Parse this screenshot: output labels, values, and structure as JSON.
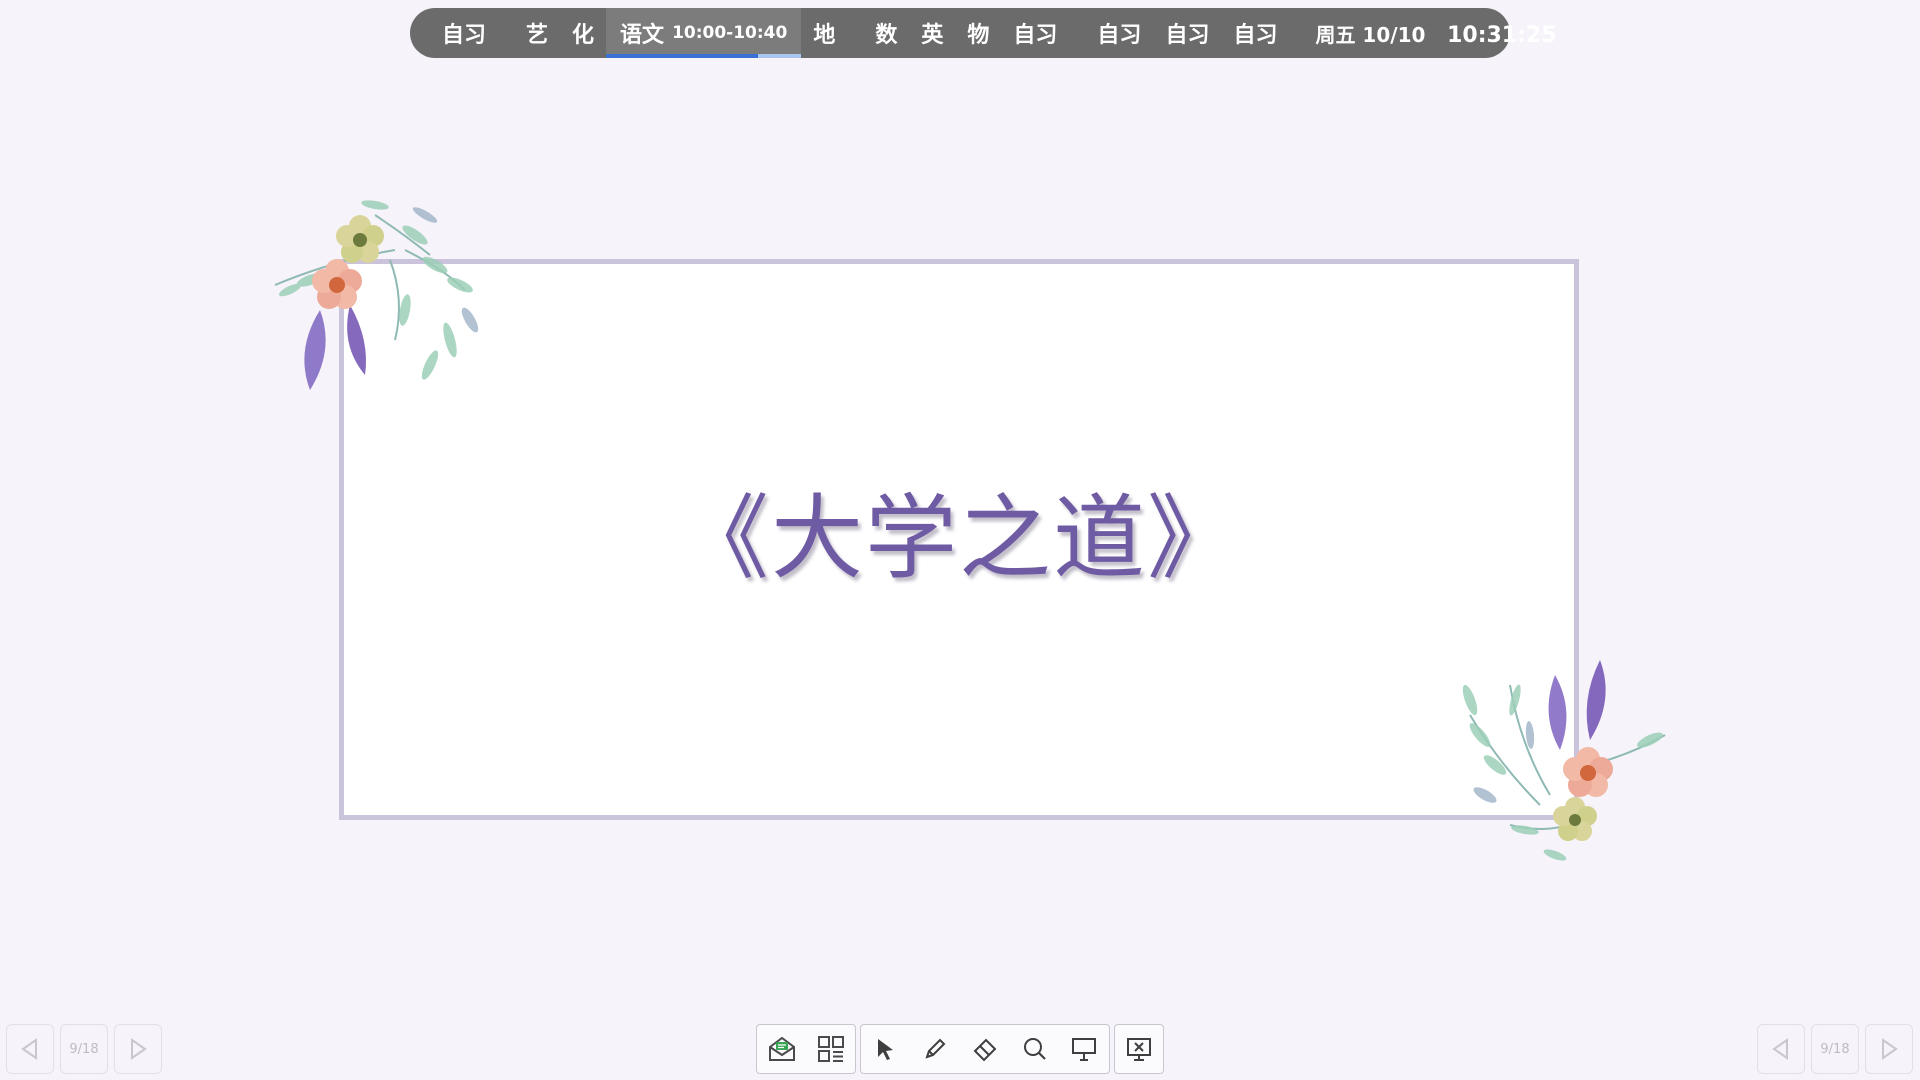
{
  "schedule_bar": {
    "items": [
      {
        "label": "自习"
      },
      {
        "label": "艺"
      },
      {
        "label": "化"
      },
      {
        "label": "语文",
        "time": "10:00-10:40",
        "current": true,
        "progress": 0.78
      },
      {
        "label": "地"
      },
      {
        "label": "数"
      },
      {
        "label": "英"
      },
      {
        "label": "物"
      },
      {
        "label": "自习"
      },
      {
        "label": "自习"
      },
      {
        "label": "自习"
      },
      {
        "label": "自习"
      }
    ],
    "date": "周五 10/10",
    "clock": "10:31:25"
  },
  "slide": {
    "title": "《大学之道》",
    "colors": {
      "title": "#6f5ba3",
      "frame_border": "#cbc3dc",
      "background": "#f6f3fa"
    }
  },
  "left_nav": {
    "page": "9/18",
    "prev_icon": "triangle-left-icon",
    "next_icon": "triangle-right-icon"
  },
  "right_nav": {
    "page": "9/18",
    "prev_icon": "triangle-left-icon",
    "next_icon": "triangle-right-icon"
  },
  "toolbar": {
    "tools": [
      "envelope-icon",
      "qr-grid-icon",
      "pointer-icon",
      "pen-icon",
      "eraser-icon",
      "search-icon",
      "whiteboard-icon",
      "exit-presentation-icon"
    ]
  }
}
